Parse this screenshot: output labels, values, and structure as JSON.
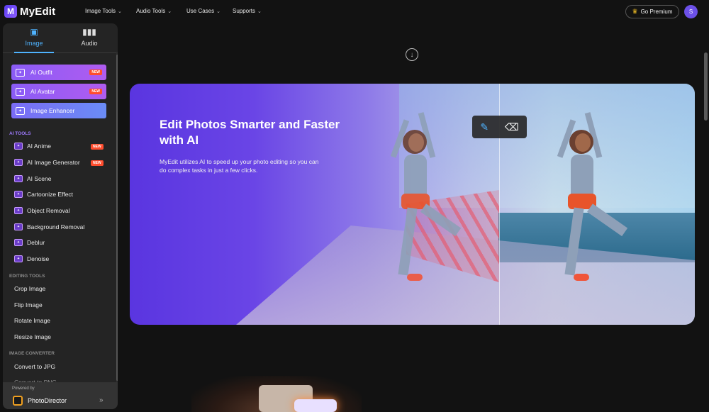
{
  "header": {
    "logo_glyph": "M",
    "brand": "MyEdit",
    "nav": [
      "Image Tools",
      "Audio Tools",
      "Use Cases",
      "Supports"
    ],
    "premium_label": "Go Premium",
    "avatar_initial": "S"
  },
  "sidebar": {
    "tabs": [
      {
        "label": "Image",
        "icon": "image-icon",
        "active": true
      },
      {
        "label": "Audio",
        "icon": "waveform-icon",
        "active": false
      }
    ],
    "featured": [
      {
        "label": "AI Outfit",
        "badge": "NEW"
      },
      {
        "label": "AI Avatar",
        "badge": "NEW"
      },
      {
        "label": "Image Enhancer",
        "badge": ""
      }
    ],
    "sections": {
      "ai_tools": "AI TOOLS",
      "editing_tools": "EDITING TOOLS",
      "image_converter": "IMAGE CONVERTER"
    },
    "ai_tools": [
      {
        "label": "AI Anime",
        "badge": "NEW"
      },
      {
        "label": "AI Image Generator",
        "badge": "NEW"
      },
      {
        "label": "AI Scene",
        "badge": ""
      },
      {
        "label": "Cartoonize Effect",
        "badge": ""
      },
      {
        "label": "Object Removal",
        "badge": ""
      },
      {
        "label": "Background Removal",
        "badge": ""
      },
      {
        "label": "Deblur",
        "badge": ""
      },
      {
        "label": "Denoise",
        "badge": ""
      }
    ],
    "editing_tools": [
      "Crop Image",
      "Flip Image",
      "Rotate Image",
      "Resize Image"
    ],
    "converter": [
      "Convert to JPG",
      "Convert to PNG"
    ],
    "powered_label": "Powered by",
    "powered_name": "PhotoDirector"
  },
  "hero": {
    "title": "Edit Photos Smarter and Faster with AI",
    "description": "MyEdit utilizes AI to speed up your photo editing so you can do complex tasks in just a few clicks."
  },
  "colors": {
    "accent": "#4fb3ff",
    "badge": "#ff4d2e",
    "brand_purple": "#6c50e8"
  }
}
